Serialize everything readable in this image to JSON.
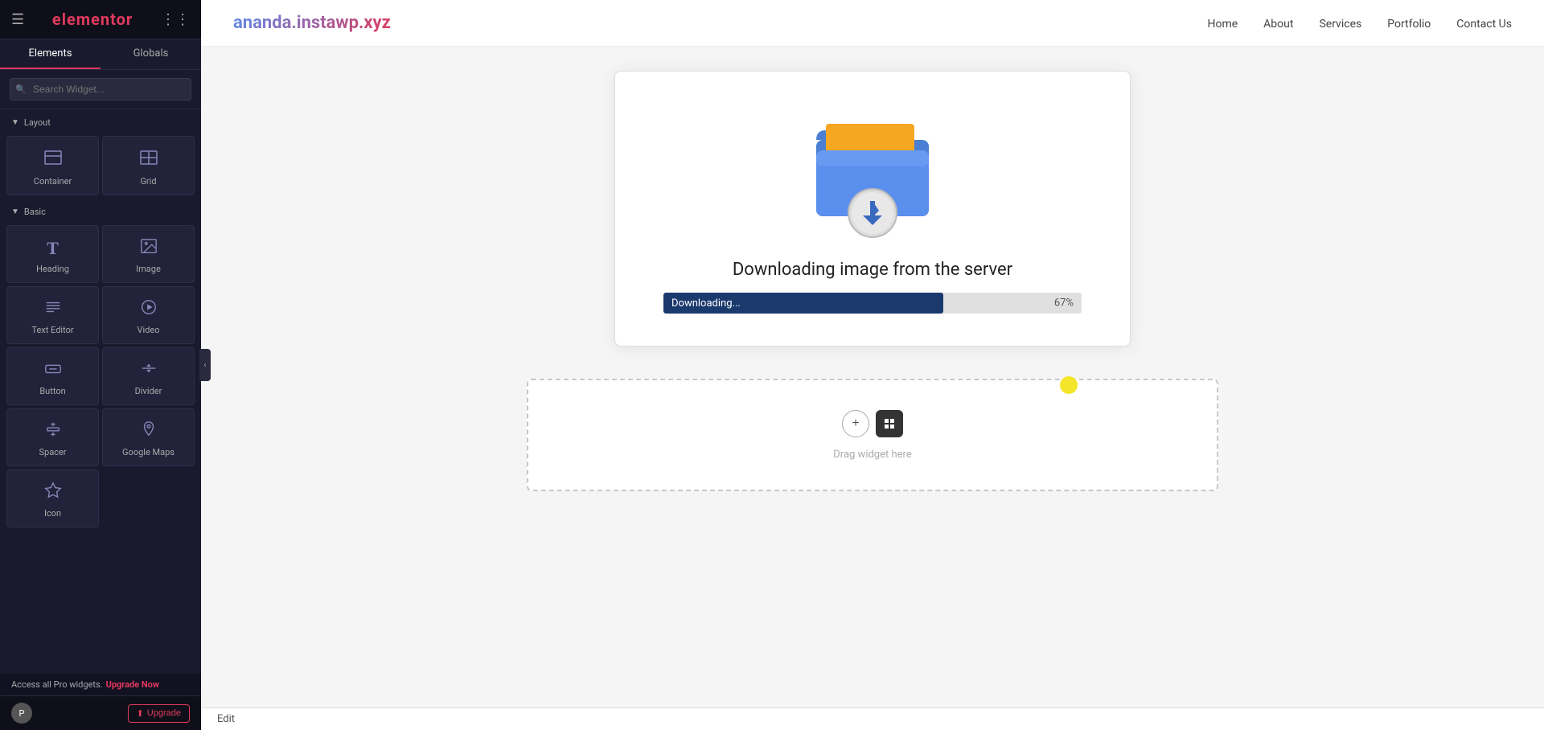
{
  "sidebar": {
    "logo": "elementor",
    "hamburger_label": "☰",
    "grid_label": "⋮⋮",
    "tabs": [
      {
        "id": "elements",
        "label": "Elements",
        "active": true
      },
      {
        "id": "globals",
        "label": "Globals",
        "active": false
      }
    ],
    "search_placeholder": "Search Widget...",
    "sections": [
      {
        "id": "layout",
        "label": "Layout",
        "widgets": [
          {
            "id": "container",
            "label": "Container",
            "icon": "⊞"
          },
          {
            "id": "grid",
            "label": "Grid",
            "icon": "⊟"
          }
        ]
      },
      {
        "id": "basic",
        "label": "Basic",
        "widgets": [
          {
            "id": "heading",
            "label": "Heading",
            "icon": "T"
          },
          {
            "id": "image",
            "label": "Image",
            "icon": "🖼"
          },
          {
            "id": "text-editor",
            "label": "Text Editor",
            "icon": "≡"
          },
          {
            "id": "video",
            "label": "Video",
            "icon": "▶"
          },
          {
            "id": "button",
            "label": "Button",
            "icon": "⬛"
          },
          {
            "id": "divider",
            "label": "Divider",
            "icon": "⊟"
          },
          {
            "id": "spacer",
            "label": "Spacer",
            "icon": "↕"
          },
          {
            "id": "google-maps",
            "label": "Google Maps",
            "icon": "📍"
          },
          {
            "id": "icon",
            "label": "Icon",
            "icon": "★"
          }
        ]
      }
    ],
    "footer": {
      "upgrade_label": "Upgrade",
      "upgrade_icon": "⬆",
      "avatar_initials": "P"
    },
    "pro_notice": {
      "text": "Access all Pro widgets.",
      "link_label": "Upgrade Now"
    }
  },
  "topnav": {
    "logo": "ananda.instawp.xyz",
    "links": [
      {
        "id": "home",
        "label": "Home"
      },
      {
        "id": "about",
        "label": "About"
      },
      {
        "id": "services",
        "label": "Services"
      },
      {
        "id": "portfolio",
        "label": "Portfolio"
      },
      {
        "id": "contact",
        "label": "Contact Us"
      }
    ]
  },
  "download_dialog": {
    "title": "Downloading image from the server",
    "progress_label": "Downloading...",
    "progress_pct": "67%",
    "progress_value": 67
  },
  "drop_zone": {
    "text": "Drag widget here"
  },
  "edit_bar": {
    "label": "Edit"
  },
  "cursor": {
    "visible": true
  }
}
